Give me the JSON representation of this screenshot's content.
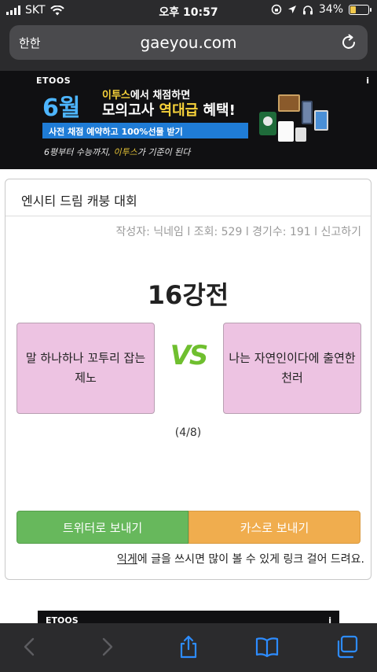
{
  "status": {
    "carrier": "SKT",
    "time": "오후 10:57",
    "battery": "34%",
    "battery_level": 0.34
  },
  "browser": {
    "reader_label": "한한",
    "url": "gaeyou.com"
  },
  "ad_top": {
    "brand": "ETOOS",
    "info": "i",
    "month": "6월",
    "line1_highlight": "이투스",
    "line1_rest": "에서 채점하면",
    "line2_main": "모의고사 ",
    "line2_highlight": "역대급",
    "line2_end": " 혜택!",
    "blue_bar": "사전 채점 예약하고 100%선물 받기",
    "script_pre": "6평부터 수능까지, ",
    "script_highlight": "이투스",
    "script_post": "가 기준이 된다"
  },
  "card": {
    "title": "엔시티 드림 캐붕 대회",
    "meta": "작성자: 닉네임 l 조회: 529 l 경기수: 191 l 신고하기",
    "round": "16강전",
    "left_choice": "말 하나하나 꼬투리 잡는 제노",
    "vs": "VS",
    "right_choice": "나는 자연인이다에 출연한 천러",
    "progress": "(4/8)",
    "twitter_button": "트위터로 보내기",
    "kakao_button": "카스로 보내기",
    "note_link": "익게",
    "note_text": "에 글을 쓰시면 많이 볼 수 있게 링크 걸어 드려요."
  },
  "ad_bottom": {
    "brand": "ETOOS",
    "info": "i"
  },
  "colors": {
    "choice_bg": "#edc3e2",
    "vs_green": "#6fbf2f",
    "twitter_green": "#67b85c",
    "kakao_orange": "#f0ad4e",
    "chrome_dark": "#2b2b2d",
    "toolbar_blue": "#2d8cff"
  }
}
